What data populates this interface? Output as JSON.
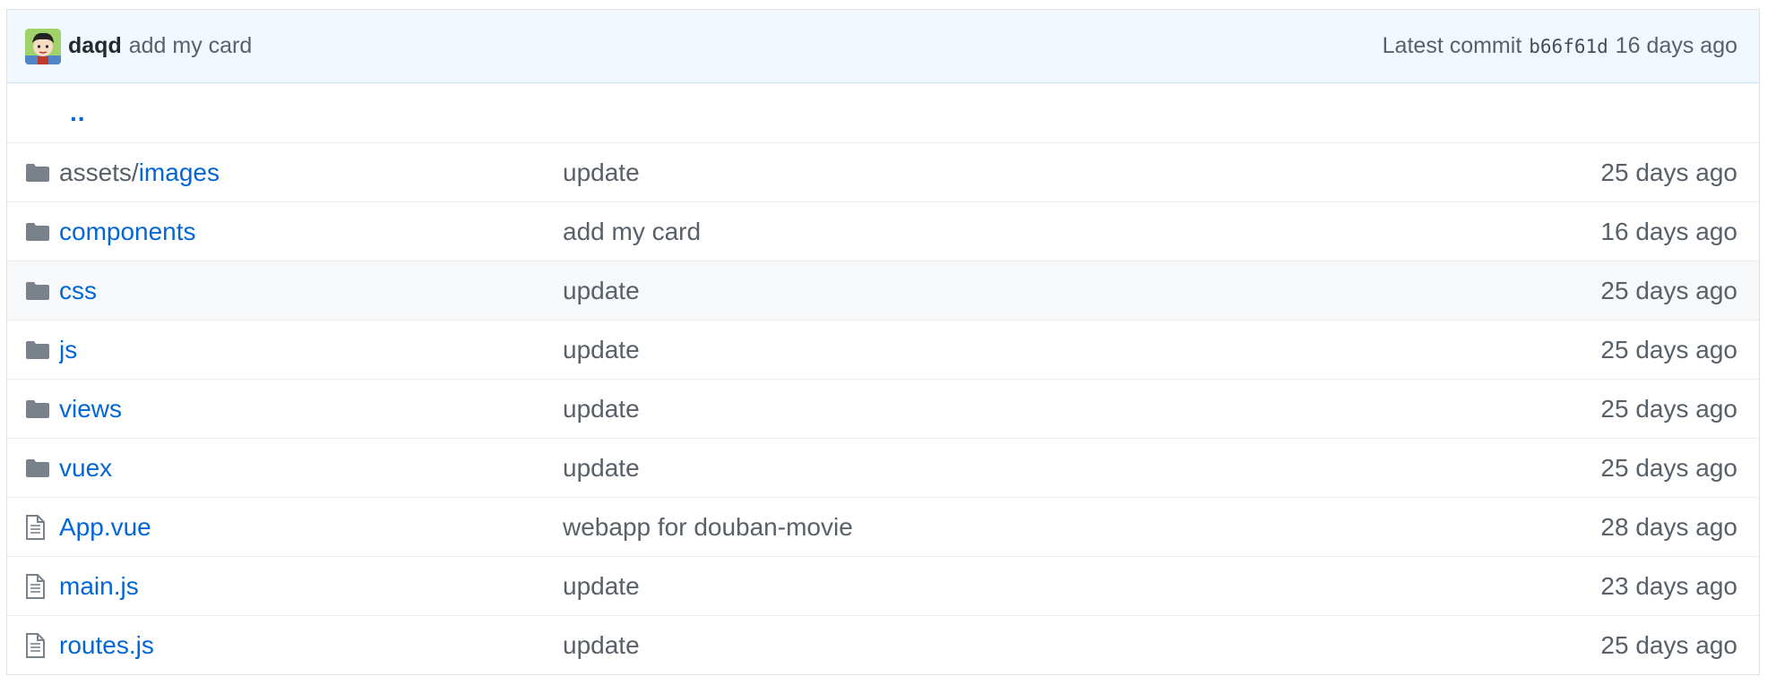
{
  "commit": {
    "author": "daqd",
    "message": "add my card",
    "latest_label": "Latest commit",
    "sha": "b66f61d",
    "age": "16 days ago"
  },
  "up_link": "..",
  "files": [
    {
      "type": "folder",
      "prefix": "assets/",
      "name": "images",
      "message": "update",
      "age": "25 days ago"
    },
    {
      "type": "folder",
      "prefix": "",
      "name": "components",
      "message": "add my card",
      "age": "16 days ago"
    },
    {
      "type": "folder",
      "prefix": "",
      "name": "css",
      "message": "update",
      "age": "25 days ago"
    },
    {
      "type": "folder",
      "prefix": "",
      "name": "js",
      "message": "update",
      "age": "25 days ago"
    },
    {
      "type": "folder",
      "prefix": "",
      "name": "views",
      "message": "update",
      "age": "25 days ago"
    },
    {
      "type": "folder",
      "prefix": "",
      "name": "vuex",
      "message": "update",
      "age": "25 days ago"
    },
    {
      "type": "file",
      "prefix": "",
      "name": "App.vue",
      "message": "webapp for douban-movie",
      "age": "28 days ago"
    },
    {
      "type": "file",
      "prefix": "",
      "name": "main.js",
      "message": "update",
      "age": "23 days ago"
    },
    {
      "type": "file",
      "prefix": "",
      "name": "routes.js",
      "message": "update",
      "age": "25 days ago"
    }
  ],
  "colors": {
    "link": "#0366d6",
    "muted": "#586069",
    "icon": "#79828b",
    "header_bg": "#f1f8ff"
  }
}
